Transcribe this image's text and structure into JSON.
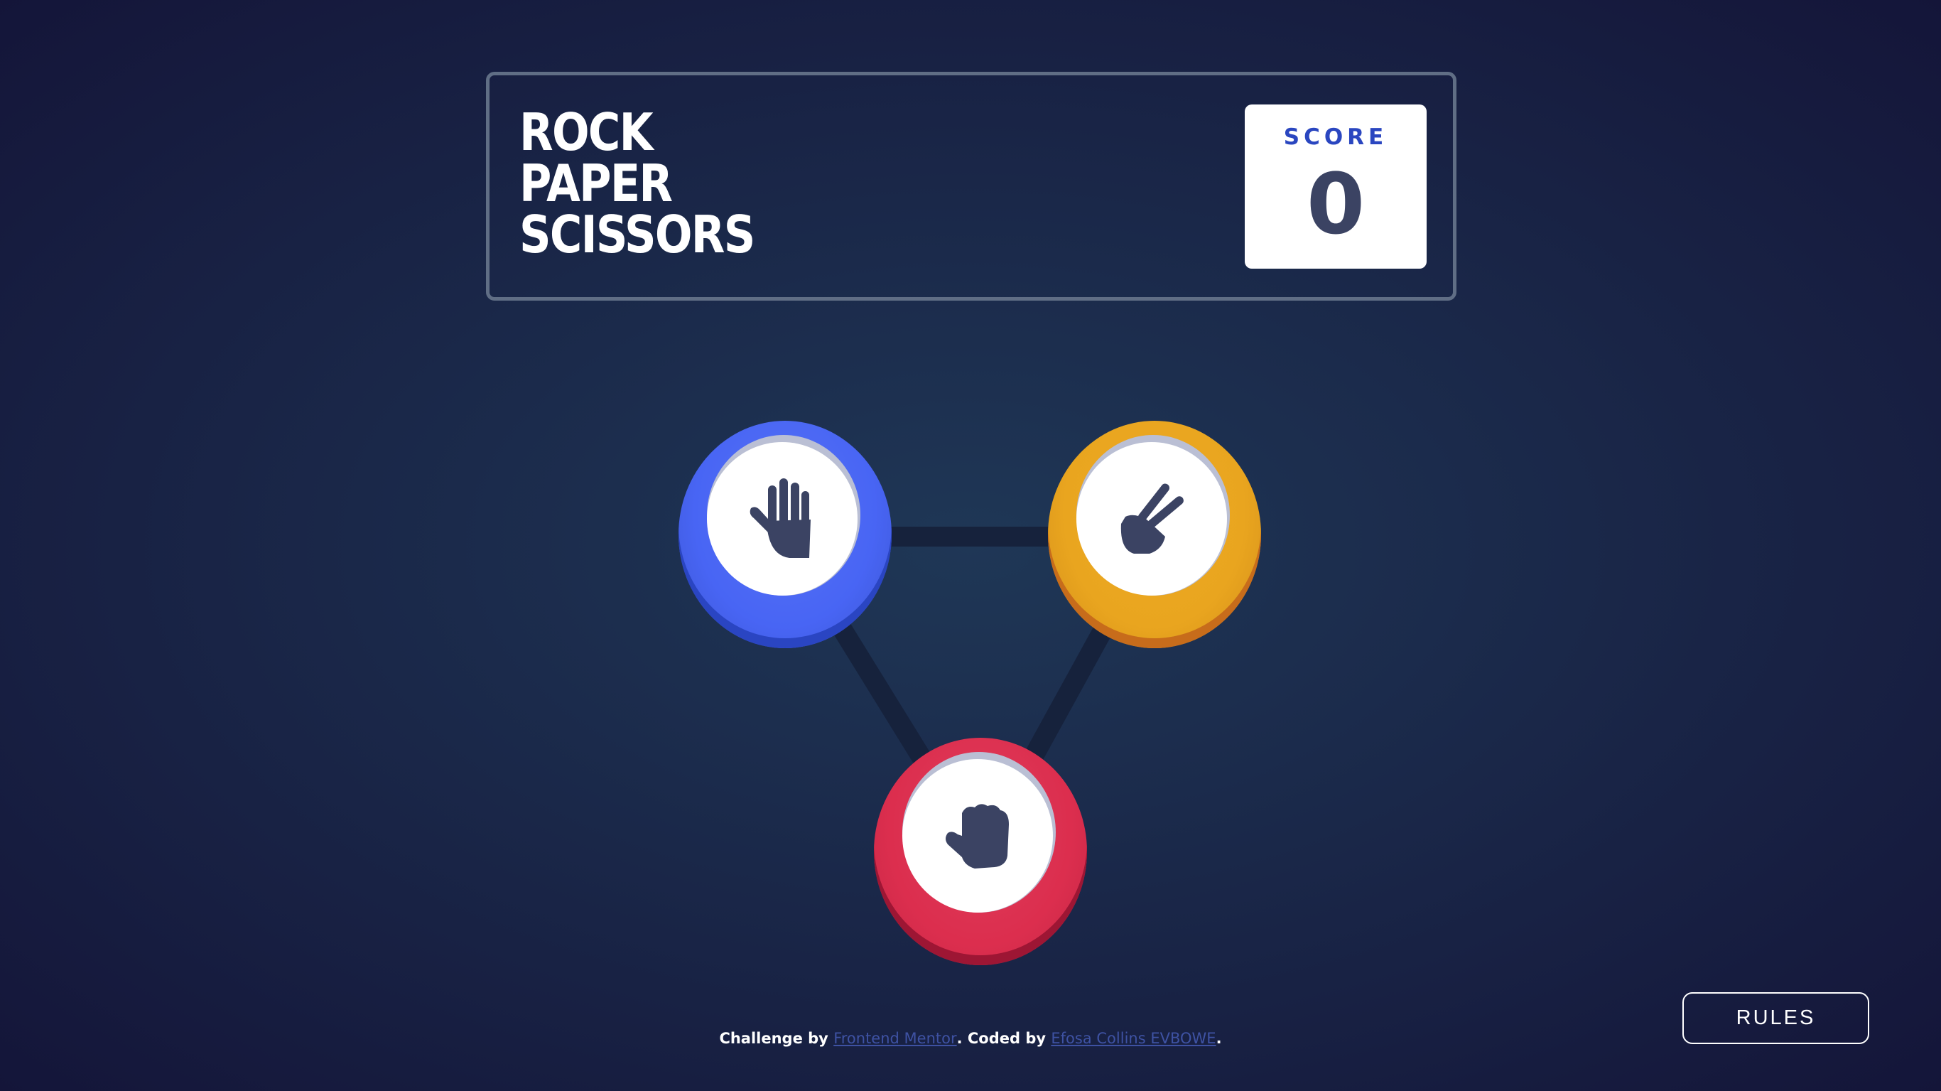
{
  "header": {
    "title_lines": [
      "ROCK",
      "PAPER",
      "SCISSORS"
    ],
    "score_label": "SCORE",
    "score_value": "0"
  },
  "tokens": {
    "paper": {
      "icon": "paper-hand-icon",
      "color": "#4865f4"
    },
    "scissors": {
      "icon": "scissors-hand-icon",
      "color": "#e9a51f"
    },
    "rock": {
      "icon": "rock-fist-icon",
      "color": "#dc2e4e"
    }
  },
  "footer": {
    "prefix": "Challenge by ",
    "link1": "Frontend Mentor",
    "middle": ". Coded by ",
    "link2": "Efosa Collins EVBOWE",
    "suffix": "."
  },
  "rules_button": "RULES",
  "colors": {
    "background": "#1f3756",
    "outline": "#606e85",
    "icon": "#3b4363"
  }
}
